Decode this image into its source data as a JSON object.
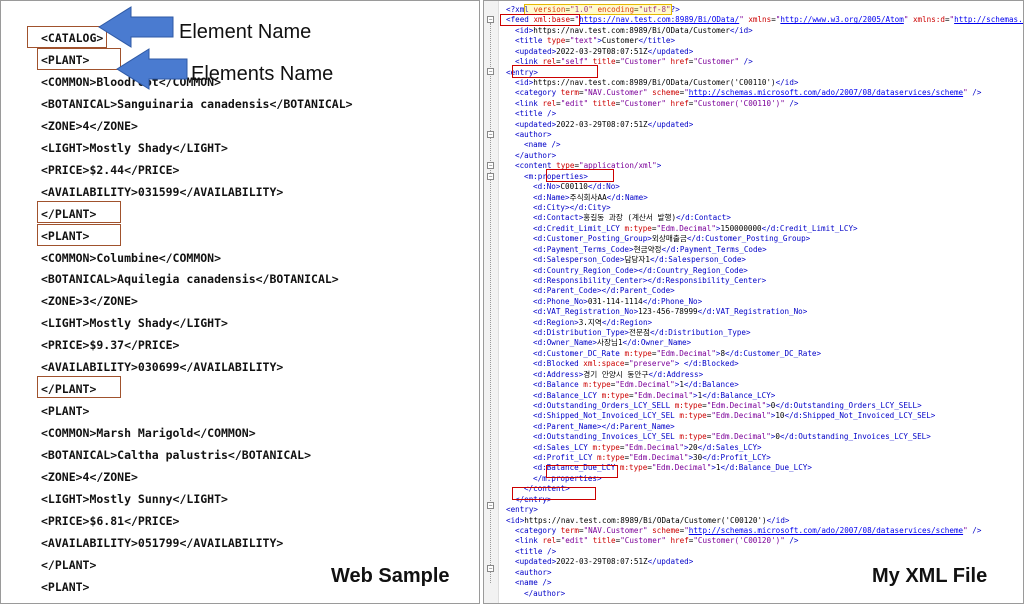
{
  "left_panel": {
    "lines": [
      "<CATALOG>",
      "<PLANT>",
      "<COMMON>Bloodroot</COMMON>",
      "<BOTANICAL>Sanguinaria canadensis</BOTANICAL>",
      "<ZONE>4</ZONE>",
      "<LIGHT>Mostly Shady</LIGHT>",
      "<PRICE>$2.44</PRICE>",
      "<AVAILABILITY>031599</AVAILABILITY>",
      "</PLANT>",
      "<PLANT>",
      "<COMMON>Columbine</COMMON>",
      "<BOTANICAL>Aquilegia canadensis</BOTANICAL>",
      "<ZONE>3</ZONE>",
      "<LIGHT>Mostly Shady</LIGHT>",
      "<PRICE>$9.37</PRICE>",
      "<AVAILABILITY>030699</AVAILABILITY>",
      "</PLANT>",
      "<PLANT>",
      "<COMMON>Marsh Marigold</COMMON>",
      "<BOTANICAL>Caltha palustris</BOTANICAL>",
      "<ZONE>4</ZONE>",
      "<LIGHT>Mostly Sunny</LIGHT>",
      "<PRICE>$6.81</PRICE>",
      "<AVAILABILITY>051799</AVAILABILITY>",
      "</PLANT>",
      "<PLANT>"
    ],
    "annotation_element_name": "Element Name",
    "annotation_elements_name": "Elements Name",
    "caption": "Web Sample"
  },
  "right_panel": {
    "caption": "My XML File",
    "lines": [
      [
        [
          "t",
          "<?xml "
        ],
        [
          "a",
          "version"
        ],
        [
          "x",
          "="
        ],
        [
          "v",
          "\"1.0\""
        ],
        [
          "a",
          " encoding"
        ],
        [
          "x",
          "="
        ],
        [
          "v",
          "\"utf-8\""
        ],
        [
          "t",
          "?>"
        ]
      ],
      [
        [
          "t",
          "<feed "
        ],
        [
          "a",
          "xml:base"
        ],
        [
          "x",
          "="
        ],
        [
          "v",
          "\""
        ],
        [
          "u",
          "https://nav.test.com:8989/Bi/OData/"
        ],
        [
          "v",
          "\""
        ],
        [
          "a",
          " xmlns"
        ],
        [
          "x",
          "="
        ],
        [
          "v",
          "\""
        ],
        [
          "u",
          "http://www.w3.org/2005/Atom"
        ],
        [
          "v",
          "\""
        ],
        [
          "a",
          " xmlns:d"
        ],
        [
          "x",
          "="
        ],
        [
          "v",
          "\""
        ],
        [
          "u",
          "http://schemas.micr"
        ]
      ],
      [
        [
          "t",
          "<id>"
        ],
        [
          "x",
          "https://nav.test.com:8989/Bi/OData/Customer"
        ],
        [
          "t",
          "</id>"
        ]
      ],
      [
        [
          "t",
          "<title "
        ],
        [
          "a",
          "type"
        ],
        [
          "x",
          "="
        ],
        [
          "v",
          "\"text\""
        ],
        [
          "t",
          ">"
        ],
        [
          "x",
          "Customer"
        ],
        [
          "t",
          "</title>"
        ]
      ],
      [
        [
          "t",
          "<updated>"
        ],
        [
          "x",
          "2022-03-29T08:07:51Z"
        ],
        [
          "t",
          "</updated>"
        ]
      ],
      [
        [
          "t",
          "<link "
        ],
        [
          "a",
          "rel"
        ],
        [
          "x",
          "="
        ],
        [
          "v",
          "\"self\""
        ],
        [
          "a",
          " title"
        ],
        [
          "x",
          "="
        ],
        [
          "v",
          "\"Customer\""
        ],
        [
          "a",
          " href"
        ],
        [
          "x",
          "="
        ],
        [
          "v",
          "\"Customer\""
        ],
        [
          "t",
          " />"
        ]
      ],
      [
        [
          "t",
          "<entry>"
        ]
      ],
      [
        [
          "t",
          "<id>"
        ],
        [
          "x",
          "https://nav.test.com:8989/Bi/OData/Customer('C00110')"
        ],
        [
          "t",
          "</id>"
        ]
      ],
      [
        [
          "t",
          "<category "
        ],
        [
          "a",
          "term"
        ],
        [
          "x",
          "="
        ],
        [
          "v",
          "\"NAV.Customer\""
        ],
        [
          "a",
          " scheme"
        ],
        [
          "x",
          "="
        ],
        [
          "v",
          "\""
        ],
        [
          "u",
          "http://schemas.microsoft.com/ado/2007/08/dataservices/scheme"
        ],
        [
          "v",
          "\""
        ],
        [
          "t",
          " />"
        ]
      ],
      [
        [
          "t",
          "<link "
        ],
        [
          "a",
          "rel"
        ],
        [
          "x",
          "="
        ],
        [
          "v",
          "\"edit\""
        ],
        [
          "a",
          " title"
        ],
        [
          "x",
          "="
        ],
        [
          "v",
          "\"Customer\""
        ],
        [
          "a",
          " href"
        ],
        [
          "x",
          "="
        ],
        [
          "v",
          "\"Customer('C00110')\""
        ],
        [
          "t",
          " />"
        ]
      ],
      [
        [
          "t",
          "<title />"
        ]
      ],
      [
        [
          "t",
          "<updated>"
        ],
        [
          "x",
          "2022-03-29T08:07:51Z"
        ],
        [
          "t",
          "</updated>"
        ]
      ],
      [
        [
          "t",
          "<author>"
        ]
      ],
      [
        [
          "t",
          "<name />"
        ]
      ],
      [
        [
          "t",
          "</author>"
        ]
      ],
      [
        [
          "t",
          "<content "
        ],
        [
          "a",
          "type"
        ],
        [
          "x",
          "="
        ],
        [
          "v",
          "\"application/xml\""
        ],
        [
          "t",
          ">"
        ]
      ],
      [
        [
          "t",
          "<m:properties>"
        ]
      ],
      [
        [
          "t",
          "<d:No>"
        ],
        [
          "x",
          "C00110"
        ],
        [
          "t",
          "</d:No>"
        ]
      ],
      [
        [
          "t",
          "<d:Name>"
        ],
        [
          "x",
          "주식회사AA"
        ],
        [
          "t",
          "</d:Name>"
        ]
      ],
      [
        [
          "t",
          "<d:City></d:City>"
        ]
      ],
      [
        [
          "t",
          "<d:Contact>"
        ],
        [
          "x",
          "홍길동 과장 (계산서 발행)"
        ],
        [
          "t",
          "</d:Contact>"
        ]
      ],
      [
        [
          "t",
          "<d:Credit_Limit_LCY "
        ],
        [
          "a",
          "m:type"
        ],
        [
          "x",
          "="
        ],
        [
          "v",
          "\"Edm.Decimal\""
        ],
        [
          "t",
          ">"
        ],
        [
          "x",
          "150000000"
        ],
        [
          "t",
          "</d:Credit_Limit_LCY>"
        ]
      ],
      [
        [
          "t",
          "<d:Customer_Posting_Group>"
        ],
        [
          "x",
          "외상매출금"
        ],
        [
          "t",
          "</d:Customer_Posting_Group>"
        ]
      ],
      [
        [
          "t",
          "<d:Payment_Terms_Code>"
        ],
        [
          "x",
          "현금약정"
        ],
        [
          "t",
          "</d:Payment_Terms_Code>"
        ]
      ],
      [
        [
          "t",
          "<d:Salesperson_Code>"
        ],
        [
          "x",
          "담당자1"
        ],
        [
          "t",
          "</d:Salesperson_Code>"
        ]
      ],
      [
        [
          "t",
          "<d:Country_Region_Code></d:Country_Region_Code>"
        ]
      ],
      [
        [
          "t",
          "<d:Responsibility_Center></d:Responsibility_Center>"
        ]
      ],
      [
        [
          "t",
          "<d:Parent_Code></d:Parent_Code>"
        ]
      ],
      [
        [
          "t",
          "<d:Phone_No>"
        ],
        [
          "x",
          "031-114-1114"
        ],
        [
          "t",
          "</d:Phone_No>"
        ]
      ],
      [
        [
          "t",
          "<d:VAT_Registration_No>"
        ],
        [
          "x",
          "123-456-78999"
        ],
        [
          "t",
          "</d:VAT_Registration_No>"
        ]
      ],
      [
        [
          "t",
          "<d:Region>"
        ],
        [
          "x",
          "3.지역"
        ],
        [
          "t",
          "</d:Region>"
        ]
      ],
      [
        [
          "t",
          "<d:Distribution_Type>"
        ],
        [
          "x",
          "전문점"
        ],
        [
          "t",
          "</d:Distribution_Type>"
        ]
      ],
      [
        [
          "t",
          "<d:Owner_Name>"
        ],
        [
          "x",
          "사장님1"
        ],
        [
          "t",
          "</d:Owner_Name>"
        ]
      ],
      [
        [
          "t",
          "<d:Customer_DC_Rate "
        ],
        [
          "a",
          "m:type"
        ],
        [
          "x",
          "="
        ],
        [
          "v",
          "\"Edm.Decimal\""
        ],
        [
          "t",
          ">"
        ],
        [
          "x",
          "8"
        ],
        [
          "t",
          "</d:Customer_DC_Rate>"
        ]
      ],
      [
        [
          "t",
          "<d:Blocked "
        ],
        [
          "a",
          "xml:space"
        ],
        [
          "x",
          "="
        ],
        [
          "v",
          "\"preserve\""
        ],
        [
          "t",
          "> </d:Blocked>"
        ]
      ],
      [
        [
          "t",
          "<d:Address>"
        ],
        [
          "x",
          "경기 안양시 동안구"
        ],
        [
          "t",
          "</d:Address>"
        ]
      ],
      [
        [
          "t",
          "<d:Balance "
        ],
        [
          "a",
          "m:type"
        ],
        [
          "x",
          "="
        ],
        [
          "v",
          "\"Edm.Decimal\""
        ],
        [
          "t",
          ">"
        ],
        [
          "x",
          "1"
        ],
        [
          "t",
          "</d:Balance>"
        ]
      ],
      [
        [
          "t",
          "<d:Balance_LCY "
        ],
        [
          "a",
          "m:type"
        ],
        [
          "x",
          "="
        ],
        [
          "v",
          "\"Edm.Decimal\""
        ],
        [
          "t",
          ">"
        ],
        [
          "x",
          "1"
        ],
        [
          "t",
          "</d:Balance_LCY>"
        ]
      ],
      [
        [
          "t",
          "<d:Outstanding_Orders_LCY_SELL "
        ],
        [
          "a",
          "m:type"
        ],
        [
          "x",
          "="
        ],
        [
          "v",
          "\"Edm.Decimal\""
        ],
        [
          "t",
          ">"
        ],
        [
          "x",
          "0"
        ],
        [
          "t",
          "</d:Outstanding_Orders_LCY_SELL>"
        ]
      ],
      [
        [
          "t",
          "<d:Shipped_Not_Invoiced_LCY_SEL "
        ],
        [
          "a",
          "m:type"
        ],
        [
          "x",
          "="
        ],
        [
          "v",
          "\"Edm.Decimal\""
        ],
        [
          "t",
          ">"
        ],
        [
          "x",
          "10"
        ],
        [
          "t",
          "</d:Shipped_Not_Invoiced_LCY_SEL>"
        ]
      ],
      [
        [
          "t",
          "<d:Parent_Name></d:Parent_Name>"
        ]
      ],
      [
        [
          "t",
          "<d:Outstanding_Invoices_LCY_SEL "
        ],
        [
          "a",
          "m:type"
        ],
        [
          "x",
          "="
        ],
        [
          "v",
          "\"Edm.Decimal\""
        ],
        [
          "t",
          ">"
        ],
        [
          "x",
          "0"
        ],
        [
          "t",
          "</d:Outstanding_Invoices_LCY_SEL>"
        ]
      ],
      [
        [
          "t",
          "<d:Sales_LCY "
        ],
        [
          "a",
          "m:type"
        ],
        [
          "x",
          "="
        ],
        [
          "v",
          "\"Edm.Decimal\""
        ],
        [
          "t",
          ">"
        ],
        [
          "x",
          "20"
        ],
        [
          "t",
          "</d:Sales_LCY>"
        ]
      ],
      [
        [
          "t",
          "<d:Profit_LCY "
        ],
        [
          "a",
          "m:type"
        ],
        [
          "x",
          "="
        ],
        [
          "v",
          "\"Edm.Decimal\""
        ],
        [
          "t",
          ">"
        ],
        [
          "x",
          "30"
        ],
        [
          "t",
          "</d:Profit_LCY>"
        ]
      ],
      [
        [
          "t",
          "<d:Balance_Due_LCY "
        ],
        [
          "a",
          "m:type"
        ],
        [
          "x",
          "="
        ],
        [
          "v",
          "\"Edm.Decimal\""
        ],
        [
          "t",
          ">"
        ],
        [
          "x",
          "1"
        ],
        [
          "t",
          "</d:Balance_Due_LCY>"
        ]
      ],
      [
        [
          "t",
          "</m:properties>"
        ]
      ],
      [
        [
          "t",
          "</content>"
        ]
      ],
      [
        [
          "t",
          "</entry>"
        ]
      ],
      [
        [
          "t",
          "<entry>"
        ]
      ],
      [
        [
          "t",
          "<id>"
        ],
        [
          "x",
          "https://nav.test.com:8989/Bi/OData/Customer('C00120')"
        ],
        [
          "t",
          "</id>"
        ]
      ],
      [
        [
          "t",
          "<category "
        ],
        [
          "a",
          "term"
        ],
        [
          "x",
          "="
        ],
        [
          "v",
          "\"NAV.Customer\""
        ],
        [
          "a",
          " scheme"
        ],
        [
          "x",
          "="
        ],
        [
          "v",
          "\""
        ],
        [
          "u",
          "http://schemas.microsoft.com/ado/2007/08/dataservices/scheme"
        ],
        [
          "v",
          "\""
        ],
        [
          "t",
          " />"
        ]
      ],
      [
        [
          "t",
          "<link "
        ],
        [
          "a",
          "rel"
        ],
        [
          "x",
          "="
        ],
        [
          "v",
          "\"edit\""
        ],
        [
          "a",
          " title"
        ],
        [
          "x",
          "="
        ],
        [
          "v",
          "\"Customer\""
        ],
        [
          "a",
          " href"
        ],
        [
          "x",
          "="
        ],
        [
          "v",
          "\"Customer('C00120')\""
        ],
        [
          "t",
          " />"
        ]
      ],
      [
        [
          "t",
          "<title />"
        ]
      ],
      [
        [
          "t",
          "<updated>"
        ],
        [
          "x",
          "2022-03-29T08:07:51Z"
        ],
        [
          "t",
          "</updated>"
        ]
      ],
      [
        [
          "t",
          "<author>"
        ]
      ],
      [
        [
          "t",
          "<name />"
        ]
      ],
      [
        [
          "t",
          "</author>"
        ]
      ]
    ]
  }
}
